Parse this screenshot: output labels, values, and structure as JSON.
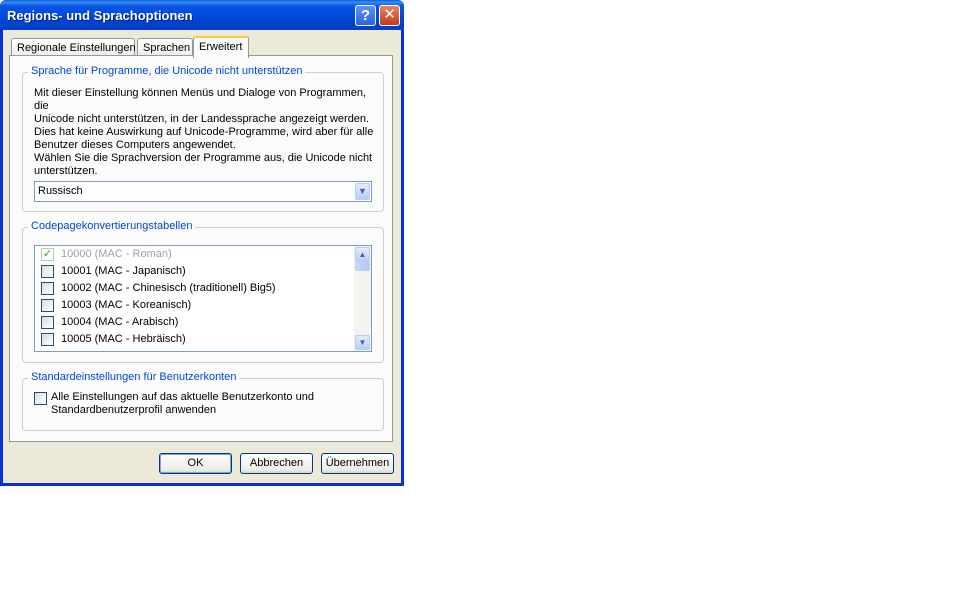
{
  "window": {
    "title": "Regions- und Sprachoptionen",
    "help_glyph": "?",
    "close_glyph": "✕"
  },
  "tabs": [
    {
      "label": "Regionale Einstellungen",
      "active": false
    },
    {
      "label": "Sprachen",
      "active": false
    },
    {
      "label": "Erweitert",
      "active": true
    }
  ],
  "nonunicode": {
    "legend": "Sprache für Programme, die Unicode nicht unterstützen",
    "description": "Mit dieser Einstellung können Menüs und Dialoge von Programmen, die\nUnicode nicht unterstützen, in der Landessprache angezeigt werden.\nDies hat keine Auswirkung auf Unicode-Programme, wird aber für alle\nBenutzer dieses Computers angewendet.",
    "prompt": "Wählen Sie die Sprachversion der Programme aus, die Unicode nicht\nunterstützen.",
    "selected_language": "Russisch",
    "dropdown_glyph": "▼"
  },
  "codepages": {
    "legend": "Codepagekonvertierungstabellen",
    "items": [
      {
        "label": "10000 (MAC - Roman)",
        "checked": true,
        "disabled": true
      },
      {
        "label": "10001 (MAC - Japanisch)",
        "checked": false,
        "disabled": false
      },
      {
        "label": "10002 (MAC - Chinesisch (traditionell) Big5)",
        "checked": false,
        "disabled": false
      },
      {
        "label": "10003 (MAC - Koreanisch)",
        "checked": false,
        "disabled": false
      },
      {
        "label": "10004 (MAC - Arabisch)",
        "checked": false,
        "disabled": false
      },
      {
        "label": "10005 (MAC - Hebräisch)",
        "checked": false,
        "disabled": false
      }
    ],
    "check_glyph": "✓",
    "scroll_up_glyph": "▲",
    "scroll_down_glyph": "▼"
  },
  "defaults": {
    "legend": "Standardeinstellungen für Benutzerkonten",
    "checkbox_label": "Alle Einstellungen auf das aktuelle Benutzerkonto und\nStandardbenutzerprofil anwenden",
    "checked": false
  },
  "buttons": {
    "ok": "OK",
    "cancel": "Abbrechen",
    "apply": "Übernehmen"
  },
  "colors": {
    "title_bar": "#0047d8",
    "dialog_face": "#ece9d8",
    "group_legend": "#0046d5",
    "active_tab_accent": "#ffc83c"
  }
}
